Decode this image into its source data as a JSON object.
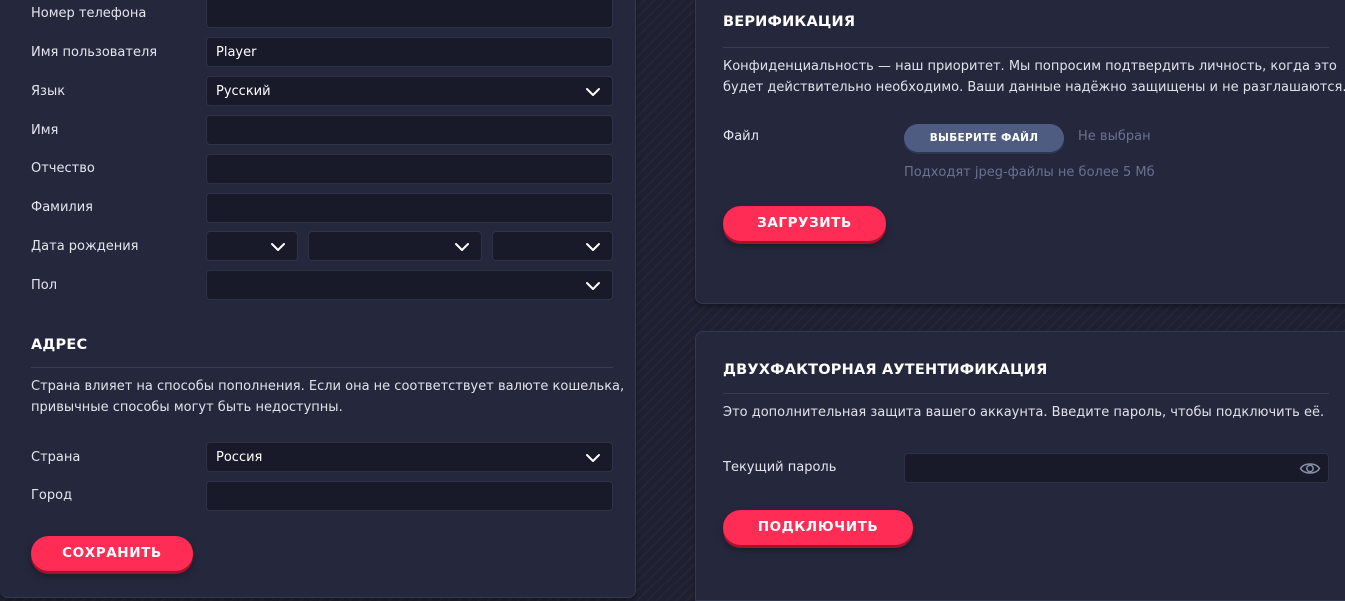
{
  "profile": {
    "fields": [
      {
        "label": "Номер телефона",
        "value": ""
      },
      {
        "label": "Имя пользователя",
        "value": "Player"
      },
      {
        "label": "Язык",
        "value": "Русский"
      },
      {
        "label": "Имя",
        "value": ""
      },
      {
        "label": "Отчество",
        "value": ""
      },
      {
        "label": "Фамилия",
        "value": ""
      },
      {
        "label": "Дата рождения",
        "day": "",
        "month": "",
        "year": ""
      },
      {
        "label": "Пол",
        "value": ""
      }
    ]
  },
  "address": {
    "title": "АДРЕС",
    "description_line1": "Страна влияет на способы пополнения. Если она не соответствует валюте кошелька,",
    "description_line2": "привычные способы могут быть недоступны.",
    "country_label": "Страна",
    "country_value": "Россия",
    "city_label": "Город",
    "city_value": ""
  },
  "save_button": "СОХРАНИТЬ",
  "verification": {
    "title": "ВЕРИФИКАЦИЯ",
    "description_line1": "Конфиденциальность — наш приоритет. Мы попросим подтвердить личность, когда это",
    "description_line2": "будет действительно необходимо. Ваши данные надёжно защищены и не разглашаются.",
    "file_label": "Файл",
    "choose_file_button": "ВЫБЕРИТЕ ФАЙЛ",
    "file_status": "Не выбран",
    "file_hint": "Подходят jpeg-файлы не более 5 Мб",
    "upload_button": "ЗАГРУЗИТЬ"
  },
  "two_factor": {
    "title": "ДВУХФАКТОРНАЯ АУТЕНТИФИКАЦИЯ",
    "description": "Это дополнительная защита вашего аккаунта. Введите пароль, чтобы подключить её.",
    "password_label": "Текущий пароль",
    "password_value": "",
    "password_toggle_icon": "eye-icon",
    "connect_button": "ПОДКЛЮЧИТЬ"
  },
  "colors": {
    "accent": "#ff2c55",
    "page_bg": "#1f2133",
    "panel_bg": "#25283d",
    "input_bg": "#181a29",
    "file_button": "#4f5c82"
  }
}
